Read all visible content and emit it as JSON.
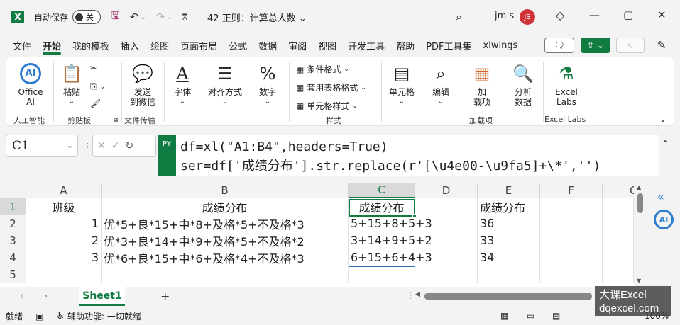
{
  "titlebar": {
    "autosave_label": "自动保存",
    "autosave_state": "关",
    "doc_title": "42 正则：计算总人数",
    "title_chevron": "⌄",
    "user_name": "jm s",
    "user_initials": "JS",
    "brand_color": "#107c41"
  },
  "menu": [
    "文件",
    "开始",
    "我的模板",
    "插入",
    "绘图",
    "页面布局",
    "公式",
    "数据",
    "审阅",
    "视图",
    "开发工具",
    "帮助",
    "PDF工具集",
    "xlwings"
  ],
  "menu_active": "开始",
  "ribbon": {
    "office_ai": [
      "Office",
      "AI"
    ],
    "paste": "粘贴",
    "send_wechat": [
      "发送",
      "到微信"
    ],
    "font": "字体",
    "align": "对齐方式",
    "number": "数字",
    "cond_format": "条件格式",
    "table_format": "套用表格格式",
    "cell_style": "单元格样式",
    "cells": "单元格",
    "edit": "编辑",
    "load": [
      "加",
      "载项"
    ],
    "analyze": [
      "分析",
      "数据"
    ],
    "excel_labs": [
      "Excel",
      "Labs"
    ],
    "groups": {
      "ai": "人工智能",
      "clipboard": "剪贴板",
      "file_transfer": "文件传输",
      "style": "样式",
      "addins": "加载项",
      "labs": "Excel Labs"
    }
  },
  "formula_bar": {
    "name_box": "C1",
    "py_badge": "PY",
    "line1": "df=xl(\"A1:B4\",headers=True)",
    "line2": "ser=df['成绩分布'].str.replace(r'[\\u4e00-\\u9fa5]+\\*','')"
  },
  "columns": [
    "A",
    "B",
    "C",
    "D",
    "E",
    "F",
    "G"
  ],
  "rows": [
    "1",
    "2",
    "3",
    "4",
    "5"
  ],
  "cells": {
    "A1": "班级",
    "B1": "成绩分布",
    "C1": "成绩分布",
    "E1": "成绩分布",
    "A2": "1",
    "B2": "优*5+良*15+中*8+及格*5+不及格*3",
    "C2": "5+15+8+5+3",
    "E2": "36",
    "A3": "2",
    "B3": "优*3+良*14+中*9+及格*5+不及格*2",
    "C3": "3+14+9+5+2",
    "E3": "33",
    "A4": "3",
    "B4": "优*6+良*15+中*6+及格*4+不及格*3",
    "C4": "6+15+6+4+3",
    "E4": "34"
  },
  "sheet_tab": "Sheet1",
  "status": {
    "ready": "就绪",
    "accessibility": "辅助功能: 一切就绪",
    "zoom": "100%"
  },
  "watermark": [
    "大课Excel",
    "dqexcel.com"
  ]
}
